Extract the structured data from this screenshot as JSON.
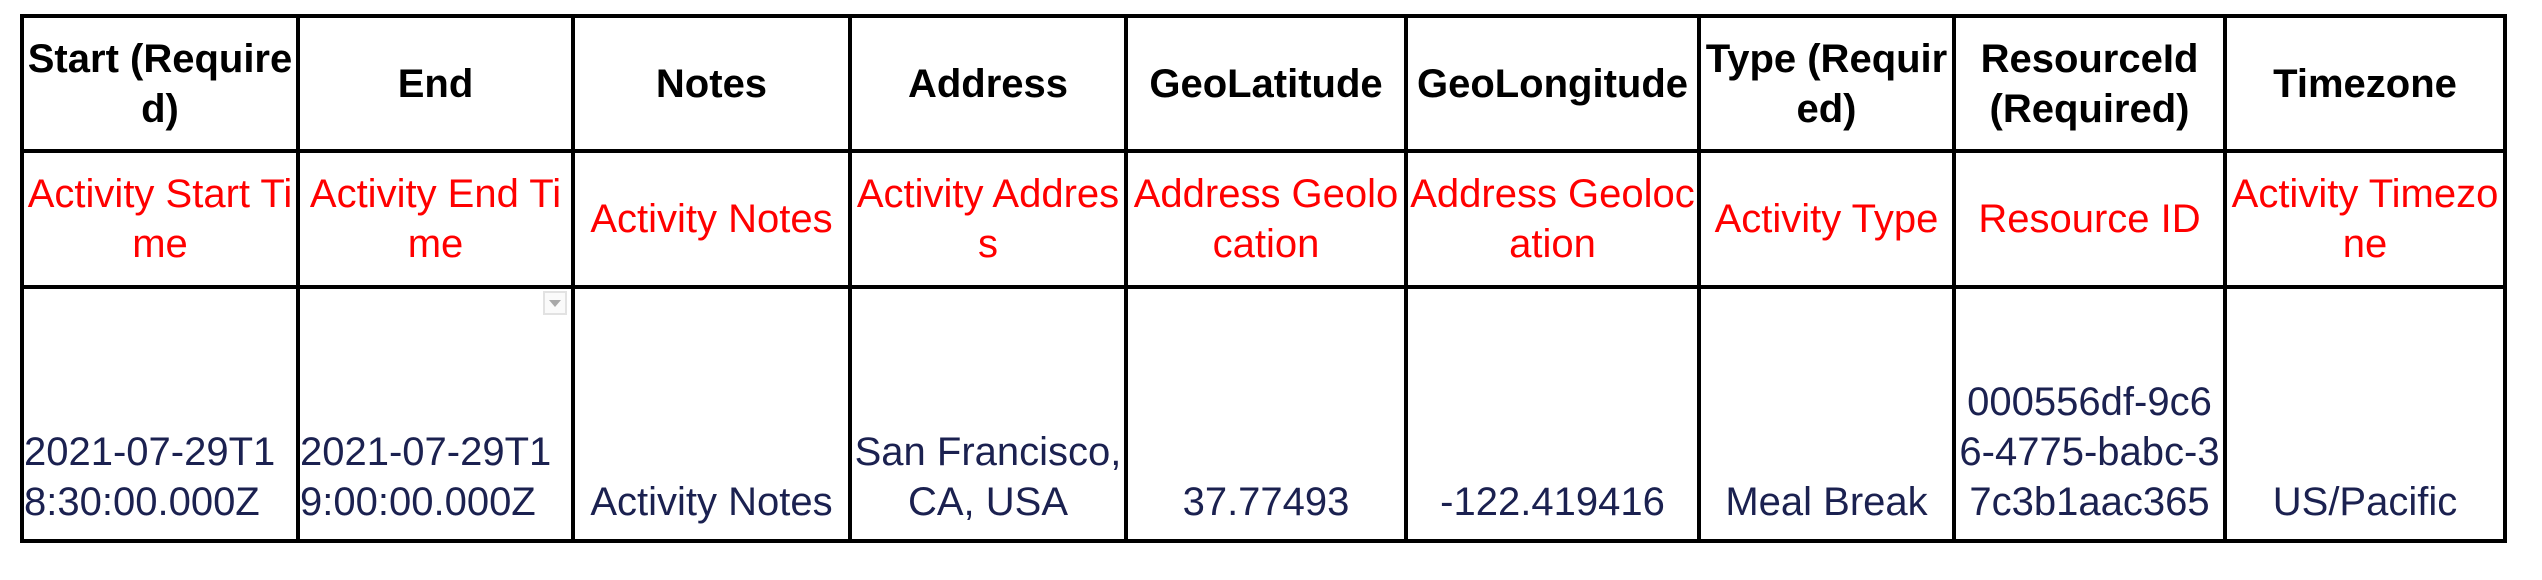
{
  "colors": {
    "header_text": "#000000",
    "description_text": "#ff0000",
    "value_text": "#1b2150",
    "border": "#000000"
  },
  "columns": [
    {
      "key": "start",
      "header": "Start (Required)",
      "description": "Activity Start Time",
      "value": "2021-07-29T18:30:00.000Z"
    },
    {
      "key": "end",
      "header": "End",
      "description": "Activity End Time",
      "value": "2021-07-29T19:00:00.000Z"
    },
    {
      "key": "notes",
      "header": "Notes",
      "description": "Activity Notes",
      "value": "Activity Notes"
    },
    {
      "key": "address",
      "header": "Address",
      "description": "Activity Address",
      "value": "San Francisco, CA, USA"
    },
    {
      "key": "geolatitude",
      "header": "GeoLatitude",
      "description": "Address Geolocation",
      "value": "37.77493"
    },
    {
      "key": "geolongitude",
      "header": "GeoLongitude",
      "description": "Address Geolocation",
      "value": "-122.419416"
    },
    {
      "key": "type",
      "header": "Type (Required)",
      "description": "Activity Type",
      "value": "Meal Break"
    },
    {
      "key": "resourceid",
      "header": "ResourceId (Required)",
      "description": "Resource ID",
      "value": "000556df-9c66-4775-babc-37c3b1aac365"
    },
    {
      "key": "timezone",
      "header": "Timezone",
      "description": "Activity Timezone",
      "value": "US/Pacific"
    }
  ],
  "icons": {
    "cell_dropdown": "chevron-down-icon"
  }
}
